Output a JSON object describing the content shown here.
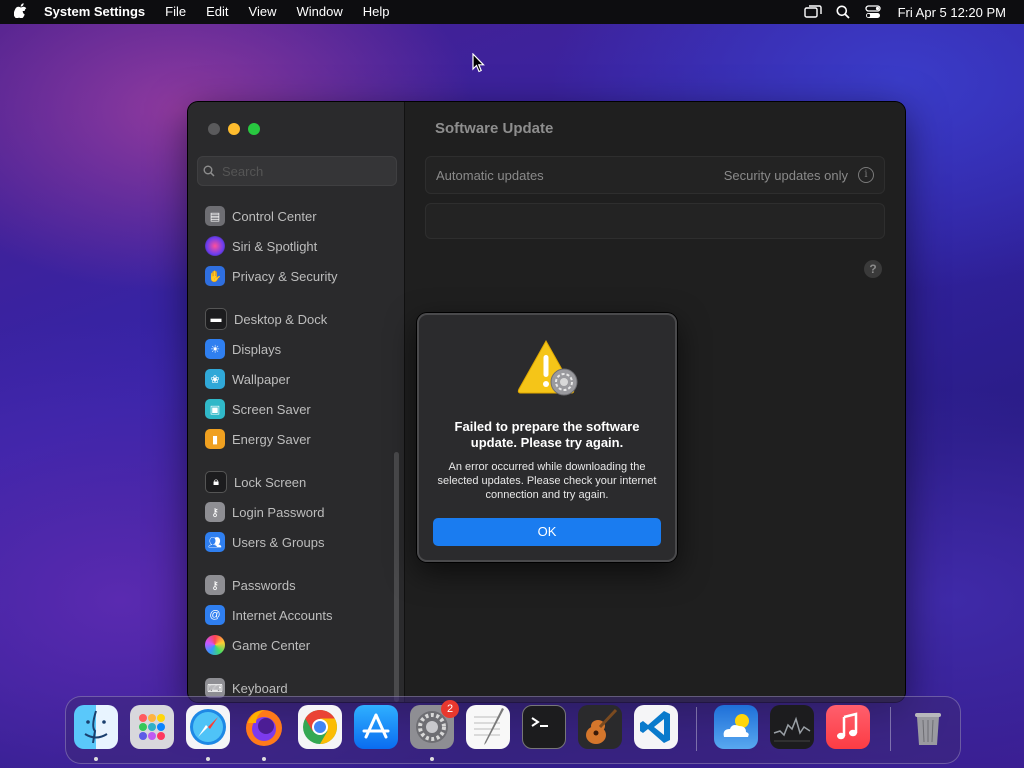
{
  "menubar": {
    "app_name": "System Settings",
    "menus": [
      "File",
      "Edit",
      "View",
      "Window",
      "Help"
    ],
    "clock": "Fri Apr 5  12:20 PM"
  },
  "sidebar": {
    "search_placeholder": "Search",
    "items": [
      {
        "label": "Control Center",
        "icon": "control-center-icon",
        "color": "#6e6e73"
      },
      {
        "label": "Siri & Spotlight",
        "icon": "siri-icon",
        "color": "#c23bd4"
      },
      {
        "label": "Privacy & Security",
        "icon": "hand-icon",
        "color": "#2f6fe0"
      },
      {
        "label": "Desktop & Dock",
        "icon": "desktop-icon",
        "color": "#1c1c1e"
      },
      {
        "label": "Displays",
        "icon": "sun-icon",
        "color": "#2f7ff0"
      },
      {
        "label": "Wallpaper",
        "icon": "wallpaper-icon",
        "color": "#30a8d8"
      },
      {
        "label": "Screen Saver",
        "icon": "screen-saver-icon",
        "color": "#30b8c8"
      },
      {
        "label": "Energy Saver",
        "icon": "battery-icon",
        "color": "#f0a020"
      },
      {
        "label": "Lock Screen",
        "icon": "lock-icon",
        "color": "#1c1c1e"
      },
      {
        "label": "Login Password",
        "icon": "key-icon",
        "color": "#8e8e93"
      },
      {
        "label": "Users & Groups",
        "icon": "users-icon",
        "color": "#2f7ff0"
      },
      {
        "label": "Passwords",
        "icon": "key-icon",
        "color": "#8e8e93"
      },
      {
        "label": "Internet Accounts",
        "icon": "at-icon",
        "color": "#2f7ff0"
      },
      {
        "label": "Game Center",
        "icon": "game-center-icon",
        "color": "#e8e8e8"
      },
      {
        "label": "Keyboard",
        "icon": "keyboard-icon",
        "color": "#8e8e93"
      }
    ]
  },
  "content": {
    "title": "Software Update",
    "auto_updates_label": "Automatic updates",
    "auto_updates_value": "Security updates only",
    "help": "?"
  },
  "dialog": {
    "title": "Failed to prepare the software update. Please try again.",
    "message": "An error occurred while downloading the selected updates. Please check your internet connection and try again.",
    "ok_label": "OK"
  },
  "dock": {
    "apps": [
      "Finder",
      "Launchpad",
      "Safari",
      "Firefox",
      "Chrome",
      "App Store",
      "System Settings",
      "TextEdit",
      "Terminal",
      "GarageBand",
      "Visual Studio Code",
      "Weather",
      "Stocks",
      "Music",
      "Trash"
    ],
    "settings_badge": "2"
  }
}
